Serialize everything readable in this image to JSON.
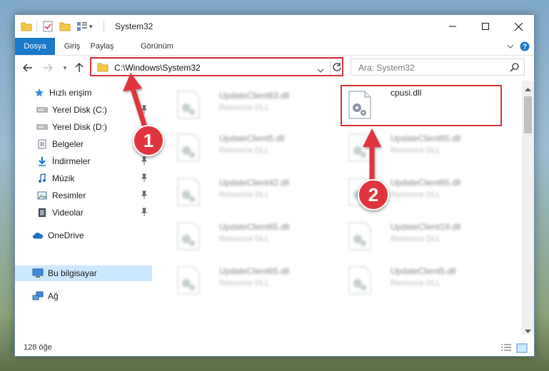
{
  "window": {
    "title": "System32"
  },
  "ribbon": {
    "tabs": [
      "Dosya",
      "Giriş",
      "Paylaş",
      "Görünüm"
    ]
  },
  "address": {
    "path": "C:\\Windows\\System32"
  },
  "search": {
    "placeholder": "Ara: System32"
  },
  "sidebar": {
    "items": [
      {
        "label": "Hızlı erişim",
        "icon": "star-icon"
      },
      {
        "label": "Yerel Disk (C:)",
        "icon": "drive-icon",
        "pinned": true
      },
      {
        "label": "Yerel Disk (D:)",
        "icon": "drive-icon"
      },
      {
        "label": "Belgeler",
        "icon": "documents-icon"
      },
      {
        "label": "İndirmeler",
        "icon": "downloads-icon",
        "pinned": true
      },
      {
        "label": "Müzik",
        "icon": "music-icon",
        "pinned": true
      },
      {
        "label": "Resimler",
        "icon": "pictures-icon",
        "pinned": true
      },
      {
        "label": "Videolar",
        "icon": "videos-icon",
        "pinned": true
      },
      {
        "label": "OneDrive",
        "icon": "cloud-icon"
      },
      {
        "label": "Bu bilgisayar",
        "icon": "computer-icon",
        "selected": true
      },
      {
        "label": "Ağ",
        "icon": "network-icon"
      }
    ]
  },
  "files": [
    {
      "name": "UpdateClient63.dll",
      "type": "Resource DLL"
    },
    {
      "name": "cpusi.dll",
      "type": ""
    },
    {
      "name": "UpdateClient5.dll",
      "type": "Resource DLL"
    },
    {
      "name": "UpdateClient65.dll",
      "type": "Resource DLL"
    },
    {
      "name": "UpdateClient42.dll",
      "type": "Resource DLL"
    },
    {
      "name": "UpdateClient65.dll",
      "type": "Resource DLL"
    },
    {
      "name": "UpdateClient65.dll",
      "type": "Resource DLL"
    },
    {
      "name": "UpdateClient19.dll",
      "type": "Resource DLL"
    },
    {
      "name": "UpdateClient65.dll",
      "type": "Resource DLL"
    },
    {
      "name": "UpdateClient5.dll",
      "type": "Resource DLL"
    }
  ],
  "status": {
    "count": "128 öğe"
  },
  "callouts": [
    "1",
    "2"
  ],
  "colors": {
    "accent": "#1979ca",
    "highlight": "#d9333b",
    "selected": "#cce8ff"
  }
}
